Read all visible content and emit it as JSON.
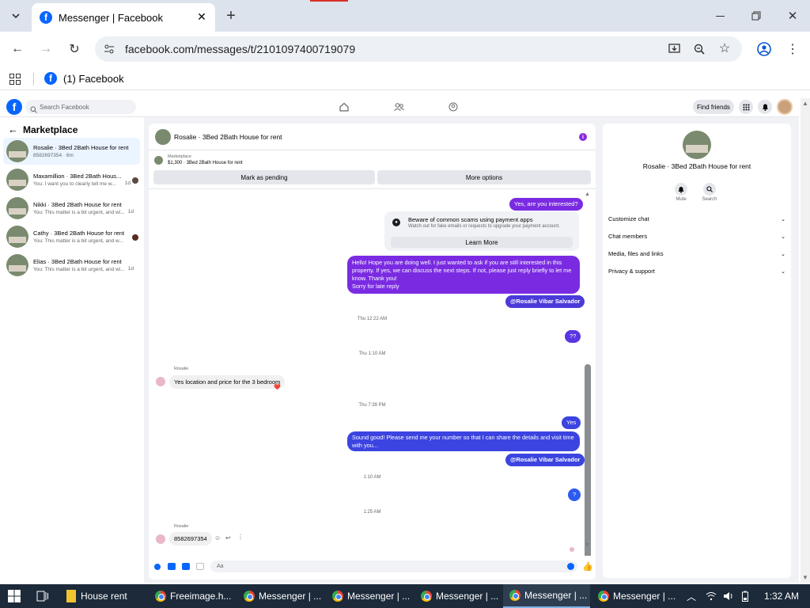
{
  "browser": {
    "tab_title": "Messenger | Facebook",
    "url": "facebook.com/messages/t/2101097400719079",
    "bookmark": "(1) Facebook"
  },
  "fb": {
    "search_placeholder": "Search Facebook",
    "find_friends": "Find friends"
  },
  "sidebar": {
    "back_title": "Marketplace",
    "items": [
      {
        "title": "Rosalie · 3Bed 2Bath House for rent",
        "sub": "8582697354 · 6m",
        "time": ""
      },
      {
        "title": "Maxamillion · 3Bed 2Bath Hous...",
        "sub": "You: I want you to clearly tell me w...",
        "time": "1d"
      },
      {
        "title": "Nikki · 3Bed 2Bath House for rent",
        "sub": "You: This matter is a bit urgent, and wi...",
        "time": "1d"
      },
      {
        "title": "Cathy · 3Bed 2Bath House for rent",
        "sub": "You: This matter is a bit urgent, and w...",
        "time": "1d"
      },
      {
        "title": "Elias · 3Bed 2Bath House for rent",
        "sub": "You: This matter is a bit urgent, and wi...",
        "time": "1d"
      }
    ]
  },
  "chat": {
    "title": "Rosalie · 3Bed 2Bath House for rent",
    "listing_source": "Marketplace",
    "listing_line": "$1,300 · 3Bed 2Bath House for rent",
    "mark_pending": "Mark as pending",
    "more_options": "More options",
    "msg_interested": "Yes, are you interested?",
    "scam_title": "Beware of common scams using payment apps",
    "scam_sub": "Watch out for fake emails or requests to upgrade your payment account.",
    "learn_more": "Learn More",
    "msg_long": "Hello! Hope you are doing well. I just wanted to ask if you are still interested in this property. If yes, we can discuss the next steps. If not, please just reply briefly to let me know. Thank you!",
    "msg_sorry": "Sorry for late reply",
    "mention": "@Rosalie Vibar Salvador",
    "ts1": "Thu 12:22 AM",
    "msg_qq": "??",
    "ts2": "Thu 1:10 AM",
    "sender": "Rosalie",
    "msg_in1": "Yes location and price for the 3 bedroom",
    "reaction": "❤️",
    "ts3": "Thu 7:39 PM",
    "msg_yes": "Yes",
    "msg_sound": "Sound good! Please send me your number so that I can share the details and visit time with you...",
    "ts4": "1:10 AM",
    "msg_q": "?",
    "ts5": "1:25 AM",
    "msg_in2": "8582697354",
    "input_placeholder": "Aa"
  },
  "panel": {
    "title": "Rosalie · 3Bed 2Bath House for rent",
    "mute": "Mute",
    "search": "Search",
    "items": [
      "Customize chat",
      "Chat members",
      "Media, files and links",
      "Privacy & support"
    ]
  },
  "taskbar": {
    "items": [
      "House rent",
      "Freeimage.h...",
      "Messenger | ...",
      "Messenger | ...",
      "Messenger | ...",
      "Messenger | ...",
      "Messenger | ..."
    ],
    "time": "1:32 AM"
  }
}
